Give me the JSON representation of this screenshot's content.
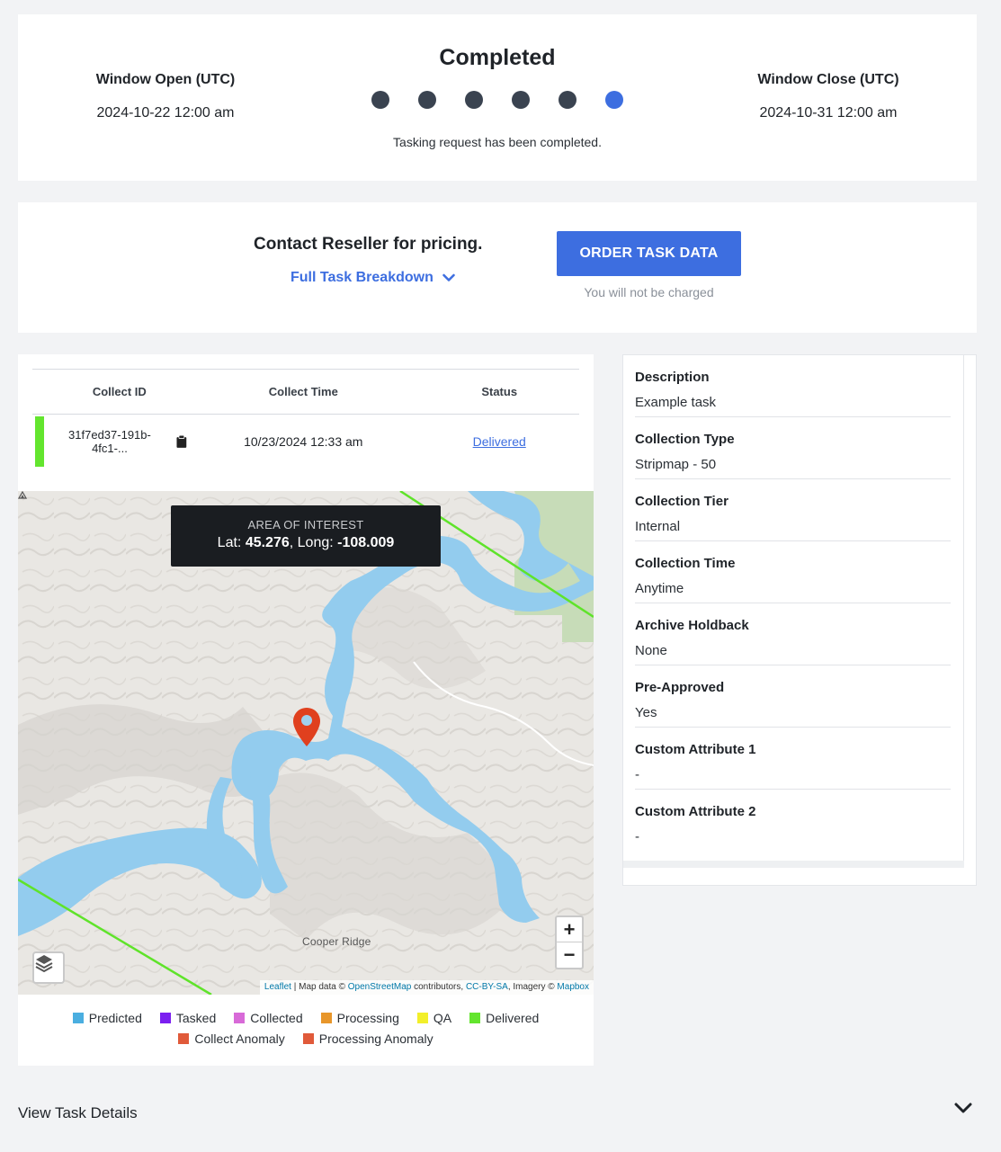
{
  "status": {
    "window_open_label": "Window Open (UTC)",
    "window_open_value": "2024-10-22 12:00 am",
    "title": "Completed",
    "message": "Tasking request has been completed.",
    "window_close_label": "Window Close (UTC)",
    "window_close_value": "2024-10-31 12:00 am",
    "steps_total": 6,
    "active_step": 6,
    "step_color": "#3a4350",
    "active_color": "#3d6ee0"
  },
  "pricing": {
    "text": "Contact Reseller for pricing.",
    "breakdown_label": "Full Task Breakdown",
    "order_button": "ORDER TASK DATA",
    "note": "You will not be charged"
  },
  "collects": {
    "headers": [
      "Collect ID",
      "Collect Time",
      "Status"
    ],
    "rows": [
      {
        "id": "31f7ed37-191b-4fc1-...",
        "time": "10/23/2024 12:33 am",
        "status": "Delivered",
        "status_color": "#63e52e"
      }
    ]
  },
  "map": {
    "tooltip_title": "AREA OF INTEREST",
    "lat_label": "Lat:",
    "lat_value": "45.276",
    "long_label": ", Long:",
    "long_value": "-108.009",
    "place": "Cooper Ridge",
    "zoom_in": "+",
    "zoom_out": "−",
    "attribution": {
      "leaflet": "Leaflet",
      "sep1": " | Map data © ",
      "osm": "OpenStreetMap",
      "sep2": " contributors, ",
      "license": "CC-BY-SA",
      "sep3": ", Imagery © ",
      "mapbox": "Mapbox"
    }
  },
  "legend": {
    "row1": [
      {
        "label": "Predicted",
        "color": "#4aaee0"
      },
      {
        "label": "Tasked",
        "color": "#7b1ff0"
      },
      {
        "label": "Collected",
        "color": "#d86ad8"
      },
      {
        "label": "Processing",
        "color": "#e8962a"
      },
      {
        "label": "QA",
        "color": "#f2ef2a"
      },
      {
        "label": "Delivered",
        "color": "#63e52e"
      }
    ],
    "row2": [
      {
        "label": "Collect Anomaly",
        "color": "#e05a3a"
      },
      {
        "label": "Processing Anomaly",
        "color": "#e05a3a"
      }
    ]
  },
  "details": [
    {
      "key": "Description",
      "value": "Example task"
    },
    {
      "key": "Collection Type",
      "value": "Stripmap - 50"
    },
    {
      "key": "Collection Tier",
      "value": "Internal"
    },
    {
      "key": "Collection Time",
      "value": "Anytime"
    },
    {
      "key": "Archive Holdback",
      "value": "None"
    },
    {
      "key": "Pre-Approved",
      "value": "Yes"
    },
    {
      "key": "Custom Attribute 1",
      "value": "-"
    },
    {
      "key": "Custom Attribute 2",
      "value": "-"
    }
  ],
  "footer": {
    "view_details": "View Task Details"
  }
}
